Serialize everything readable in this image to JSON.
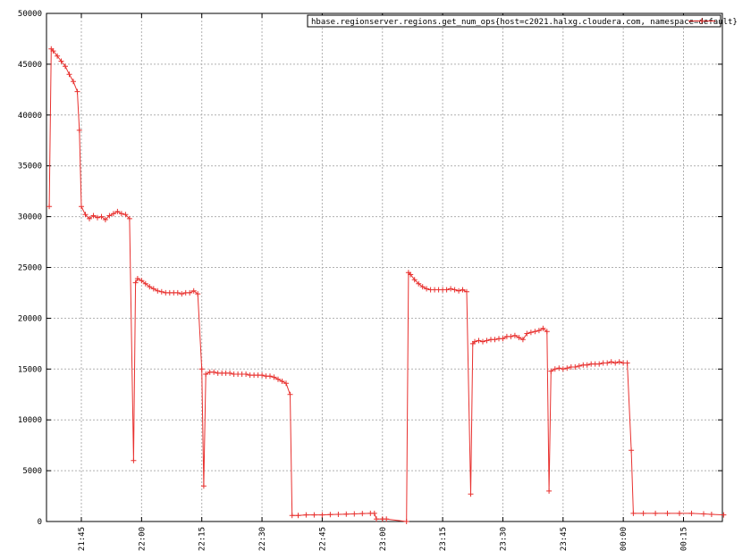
{
  "chart_data": {
    "type": "line",
    "title": "",
    "xlabel": "",
    "ylabel": "",
    "ylim": [
      0,
      50000
    ],
    "yticks": [
      0,
      5000,
      10000,
      15000,
      20000,
      25000,
      30000,
      35000,
      40000,
      45000,
      50000
    ],
    "xlim": [
      "21:37",
      "23:25"
    ],
    "xticks": [
      "21:45",
      "22:00",
      "22:15",
      "22:30",
      "22:45",
      "23:00",
      "23:15",
      "23:30",
      "23:45",
      "00:00",
      "00:15"
    ],
    "grid": true,
    "legend_position": "top-right",
    "series": [
      {
        "name": "hbase.regionserver.regions.get_num_ops{host=c2021.halxg.cloudera.com, namespace=default}",
        "color": "#e8312f",
        "marker": "plus",
        "points": [
          [
            "21:37",
            31000
          ],
          [
            "21:37.5",
            46500
          ],
          [
            "21:38",
            46300
          ],
          [
            "21:39",
            45800
          ],
          [
            "21:40",
            45300
          ],
          [
            "21:41",
            44800
          ],
          [
            "21:42",
            44000
          ],
          [
            "21:43",
            43300
          ],
          [
            "21:44",
            42300
          ],
          [
            "21:44.5",
            38500
          ],
          [
            "21:45",
            31000
          ],
          [
            "21:46",
            30200
          ],
          [
            "21:47",
            29800
          ],
          [
            "21:48",
            30100
          ],
          [
            "21:49",
            29900
          ],
          [
            "21:50",
            30000
          ],
          [
            "21:51",
            29700
          ],
          [
            "21:52",
            30100
          ],
          [
            "21:53",
            30300
          ],
          [
            "21:54",
            30500
          ],
          [
            "21:55",
            30300
          ],
          [
            "21:56",
            30200
          ],
          [
            "21:57",
            29800
          ],
          [
            "21:58",
            6000
          ],
          [
            "21:58.5",
            23500
          ],
          [
            "21:59",
            23900
          ],
          [
            "22:00",
            23700
          ],
          [
            "22:01",
            23400
          ],
          [
            "22:02",
            23100
          ],
          [
            "22:03",
            22900
          ],
          [
            "22:04",
            22700
          ],
          [
            "22:05",
            22600
          ],
          [
            "22:06",
            22500
          ],
          [
            "22:07",
            22500
          ],
          [
            "22:08",
            22500
          ],
          [
            "22:09",
            22500
          ],
          [
            "22:10",
            22400
          ],
          [
            "22:11",
            22500
          ],
          [
            "22:12",
            22500
          ],
          [
            "22:13",
            22700
          ],
          [
            "22:14",
            22400
          ],
          [
            "22:15",
            15000
          ],
          [
            "22:15.5",
            3500
          ],
          [
            "22:16",
            14500
          ],
          [
            "22:17",
            14700
          ],
          [
            "22:18",
            14700
          ],
          [
            "22:19",
            14600
          ],
          [
            "22:20",
            14600
          ],
          [
            "22:21",
            14600
          ],
          [
            "22:22",
            14600
          ],
          [
            "22:23",
            14500
          ],
          [
            "22:24",
            14500
          ],
          [
            "22:25",
            14500
          ],
          [
            "22:26",
            14500
          ],
          [
            "22:27",
            14400
          ],
          [
            "22:28",
            14400
          ],
          [
            "22:29",
            14400
          ],
          [
            "22:30",
            14400
          ],
          [
            "22:31",
            14300
          ],
          [
            "22:32",
            14300
          ],
          [
            "22:33",
            14200
          ],
          [
            "22:34",
            14000
          ],
          [
            "22:35",
            13800
          ],
          [
            "22:36",
            13600
          ],
          [
            "22:37",
            12500
          ],
          [
            "22:37.5",
            600
          ],
          [
            "22:39",
            600
          ],
          [
            "22:41",
            650
          ],
          [
            "22:43",
            650
          ],
          [
            "22:45",
            650
          ],
          [
            "22:47",
            680
          ],
          [
            "22:49",
            700
          ],
          [
            "22:51",
            720
          ],
          [
            "22:53",
            750
          ],
          [
            "22:55",
            780
          ],
          [
            "22:57",
            800
          ],
          [
            "22:58",
            800
          ],
          [
            "22:58.5",
            250
          ],
          [
            "23:00",
            250
          ],
          [
            "23:01",
            250
          ],
          [
            "23:06",
            0
          ],
          [
            "23:06.5",
            24500
          ],
          [
            "23:07",
            24300
          ],
          [
            "23:08",
            23800
          ],
          [
            "23:09",
            23400
          ],
          [
            "23:10",
            23100
          ],
          [
            "23:11",
            22900
          ],
          [
            "23:12",
            22800
          ],
          [
            "23:13",
            22800
          ],
          [
            "23:14",
            22800
          ],
          [
            "23:15",
            22800
          ],
          [
            "23:16",
            22800
          ],
          [
            "23:17",
            22900
          ],
          [
            "23:18",
            22800
          ],
          [
            "23:19",
            22700
          ],
          [
            "23:20",
            22800
          ],
          [
            "23:21",
            22600
          ],
          [
            "23:22",
            2700
          ],
          [
            "23:22.5",
            17500
          ],
          [
            "23:23",
            17700
          ],
          [
            "23:24",
            17800
          ],
          [
            "23:25",
            17700
          ],
          [
            "23:26",
            17800
          ],
          [
            "23:27",
            17900
          ],
          [
            "23:28",
            17900
          ],
          [
            "23:29",
            18000
          ],
          [
            "23:30",
            18000
          ],
          [
            "23:31",
            18200
          ],
          [
            "23:32",
            18200
          ],
          [
            "23:33",
            18300
          ],
          [
            "23:34",
            18100
          ],
          [
            "23:35",
            17900
          ],
          [
            "23:36",
            18500
          ],
          [
            "23:37",
            18600
          ],
          [
            "23:38",
            18700
          ],
          [
            "23:39",
            18800
          ],
          [
            "23:40",
            19000
          ],
          [
            "23:41",
            18700
          ],
          [
            "23:41.5",
            3000
          ],
          [
            "23:42",
            14800
          ],
          [
            "23:43",
            15000
          ],
          [
            "23:44",
            15100
          ],
          [
            "23:45",
            15000
          ],
          [
            "23:46",
            15100
          ],
          [
            "23:47",
            15200
          ],
          [
            "23:48",
            15200
          ],
          [
            "23:49",
            15300
          ],
          [
            "23:50",
            15400
          ],
          [
            "23:51",
            15400
          ],
          [
            "23:52",
            15500
          ],
          [
            "23:53",
            15500
          ],
          [
            "23:54",
            15500
          ],
          [
            "23:55",
            15600
          ],
          [
            "23:56",
            15600
          ],
          [
            "23:57",
            15700
          ],
          [
            "23:58",
            15600
          ],
          [
            "23:59",
            15700
          ],
          [
            "00:00",
            15600
          ],
          [
            "00:01",
            15600
          ],
          [
            "00:02",
            7000
          ],
          [
            "00:02.5",
            800
          ],
          [
            "00:05",
            800
          ],
          [
            "00:08",
            800
          ],
          [
            "00:11",
            800
          ],
          [
            "00:14",
            800
          ],
          [
            "00:17",
            800
          ],
          [
            "00:20",
            750
          ],
          [
            "00:22",
            700
          ],
          [
            "00:25",
            650
          ]
        ]
      }
    ]
  }
}
